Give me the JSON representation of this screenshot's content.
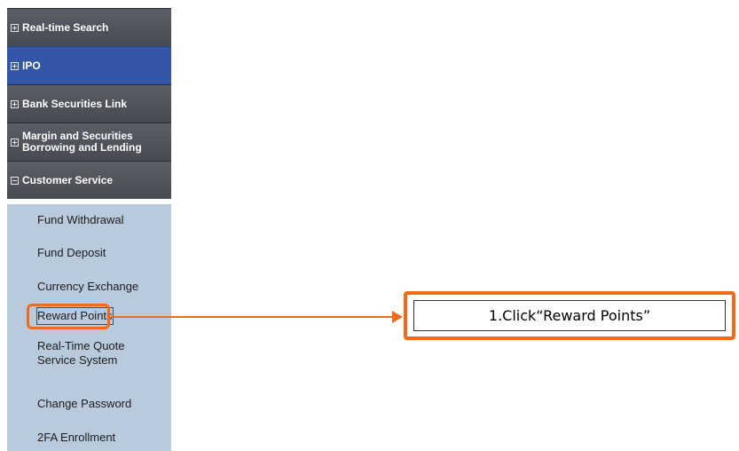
{
  "sidebar": {
    "categories": [
      {
        "label": "Real-time Search",
        "icon": "plus-box-icon"
      },
      {
        "label": "IPO",
        "icon": "plus-box-icon"
      },
      {
        "label": "Bank Securities Link",
        "icon": "plus-box-icon"
      },
      {
        "label_line1": "Margin and Securities",
        "label_line2": "Borrowing and Lending",
        "icon": "plus-box-icon"
      },
      {
        "label": "Customer Service",
        "icon": "minus-box-icon"
      }
    ],
    "customer_service_items": [
      {
        "label": "Fund Withdrawal"
      },
      {
        "label": "Fund Deposit"
      },
      {
        "label": "Currency Exchange"
      },
      {
        "label": "Reward Points"
      },
      {
        "label_line1": "Real-Time Quote",
        "label_line2": "Service System"
      },
      {
        "label": "Change Password"
      },
      {
        "label": "2FA Enrollment"
      }
    ]
  },
  "annotation": {
    "callout_text": "1.Click“Reward Points”",
    "highlight_color": "#ee6b1e"
  },
  "colors": {
    "category_bg": "#4f535b",
    "category_active_bg": "#3356a8",
    "submenu_bg": "#b9cadd"
  }
}
